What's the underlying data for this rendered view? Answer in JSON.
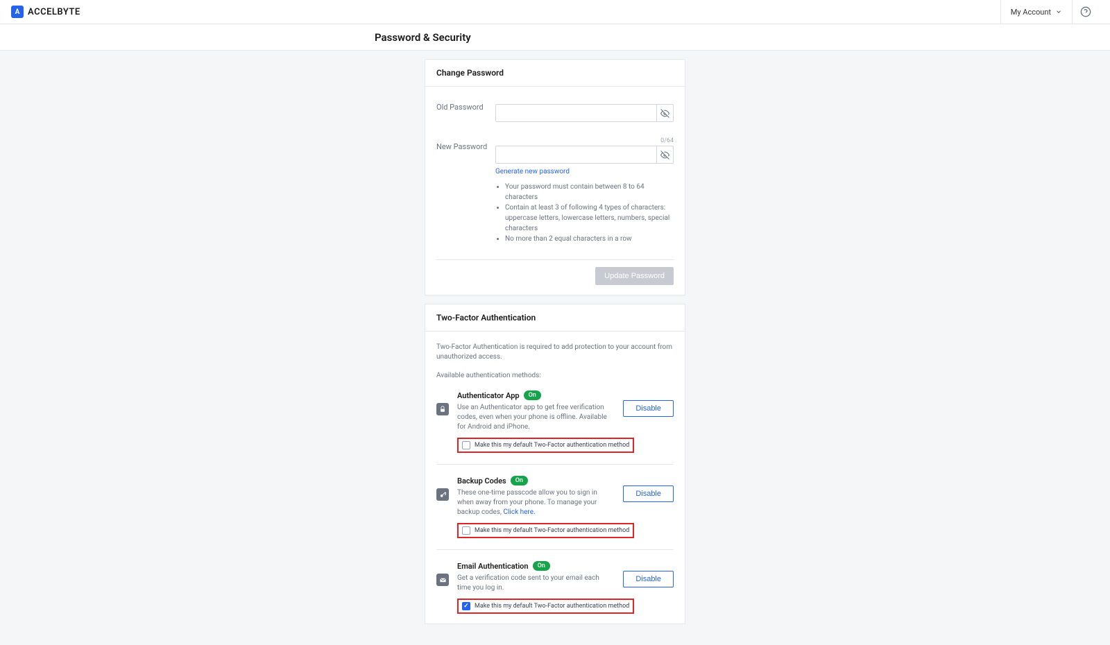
{
  "header": {
    "brand": "ACCELBYTE",
    "logo_letter": "A",
    "account_menu": "My Account"
  },
  "page_title": "Password & Security",
  "change_password": {
    "card_title": "Change Password",
    "old_label": "Old Password",
    "new_label": "New Password",
    "counter": "0/64",
    "generate_link": "Generate new password",
    "rules": [
      "Your password must contain between 8 to 64 characters",
      "Contain at least 3 of following 4 types of characters: uppercase letters, lowercase letters, numbers, special characters",
      "No more than 2 equal characters in a row"
    ],
    "update_button": "Update Password"
  },
  "tfa": {
    "card_title": "Two-Factor Authentication",
    "description": "Two-Factor Authentication is required to add protection to your account from unauthorized access.",
    "available_label": "Available authentication methods:",
    "default_checkbox_label": "Make this my default Two-Factor authentication method",
    "disable_button": "Disable",
    "on_badge": "On",
    "methods": [
      {
        "title": "Authenticator App",
        "description": "Use an Authenticator app to get free verification codes, even when your phone is offline. Available for Android and iPhone.",
        "link": null,
        "default_checked": false
      },
      {
        "title": "Backup Codes",
        "description": "These one-time passcode allow you to sign in when away from your phone. To manage your backup codes, ",
        "link": "Click here.",
        "default_checked": false
      },
      {
        "title": "Email Authentication",
        "description": "Get a verification code sent to your email each time you log in.",
        "link": null,
        "default_checked": true
      }
    ]
  }
}
